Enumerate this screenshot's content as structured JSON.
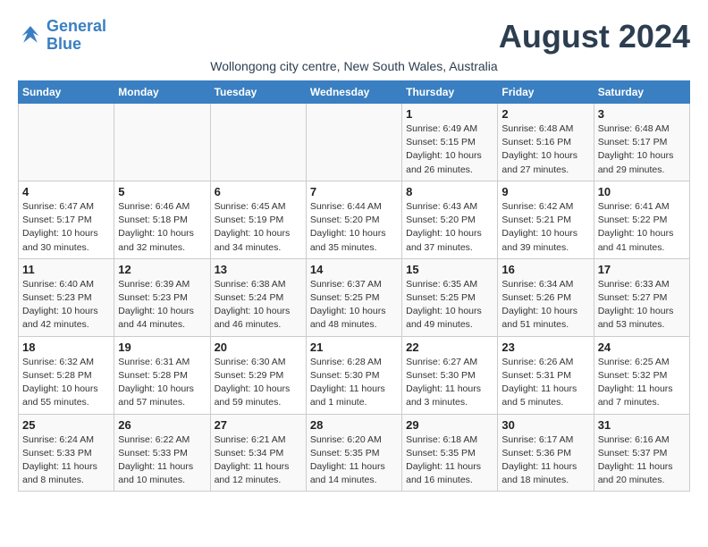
{
  "logo": {
    "line1": "General",
    "line2": "Blue"
  },
  "title": "August 2024",
  "subtitle": "Wollongong city centre, New South Wales, Australia",
  "days_of_week": [
    "Sunday",
    "Monday",
    "Tuesday",
    "Wednesday",
    "Thursday",
    "Friday",
    "Saturday"
  ],
  "weeks": [
    [
      {
        "day": "",
        "info": ""
      },
      {
        "day": "",
        "info": ""
      },
      {
        "day": "",
        "info": ""
      },
      {
        "day": "",
        "info": ""
      },
      {
        "day": "1",
        "info": "Sunrise: 6:49 AM\nSunset: 5:15 PM\nDaylight: 10 hours\nand 26 minutes."
      },
      {
        "day": "2",
        "info": "Sunrise: 6:48 AM\nSunset: 5:16 PM\nDaylight: 10 hours\nand 27 minutes."
      },
      {
        "day": "3",
        "info": "Sunrise: 6:48 AM\nSunset: 5:17 PM\nDaylight: 10 hours\nand 29 minutes."
      }
    ],
    [
      {
        "day": "4",
        "info": "Sunrise: 6:47 AM\nSunset: 5:17 PM\nDaylight: 10 hours\nand 30 minutes."
      },
      {
        "day": "5",
        "info": "Sunrise: 6:46 AM\nSunset: 5:18 PM\nDaylight: 10 hours\nand 32 minutes."
      },
      {
        "day": "6",
        "info": "Sunrise: 6:45 AM\nSunset: 5:19 PM\nDaylight: 10 hours\nand 34 minutes."
      },
      {
        "day": "7",
        "info": "Sunrise: 6:44 AM\nSunset: 5:20 PM\nDaylight: 10 hours\nand 35 minutes."
      },
      {
        "day": "8",
        "info": "Sunrise: 6:43 AM\nSunset: 5:20 PM\nDaylight: 10 hours\nand 37 minutes."
      },
      {
        "day": "9",
        "info": "Sunrise: 6:42 AM\nSunset: 5:21 PM\nDaylight: 10 hours\nand 39 minutes."
      },
      {
        "day": "10",
        "info": "Sunrise: 6:41 AM\nSunset: 5:22 PM\nDaylight: 10 hours\nand 41 minutes."
      }
    ],
    [
      {
        "day": "11",
        "info": "Sunrise: 6:40 AM\nSunset: 5:23 PM\nDaylight: 10 hours\nand 42 minutes."
      },
      {
        "day": "12",
        "info": "Sunrise: 6:39 AM\nSunset: 5:23 PM\nDaylight: 10 hours\nand 44 minutes."
      },
      {
        "day": "13",
        "info": "Sunrise: 6:38 AM\nSunset: 5:24 PM\nDaylight: 10 hours\nand 46 minutes."
      },
      {
        "day": "14",
        "info": "Sunrise: 6:37 AM\nSunset: 5:25 PM\nDaylight: 10 hours\nand 48 minutes."
      },
      {
        "day": "15",
        "info": "Sunrise: 6:35 AM\nSunset: 5:25 PM\nDaylight: 10 hours\nand 49 minutes."
      },
      {
        "day": "16",
        "info": "Sunrise: 6:34 AM\nSunset: 5:26 PM\nDaylight: 10 hours\nand 51 minutes."
      },
      {
        "day": "17",
        "info": "Sunrise: 6:33 AM\nSunset: 5:27 PM\nDaylight: 10 hours\nand 53 minutes."
      }
    ],
    [
      {
        "day": "18",
        "info": "Sunrise: 6:32 AM\nSunset: 5:28 PM\nDaylight: 10 hours\nand 55 minutes."
      },
      {
        "day": "19",
        "info": "Sunrise: 6:31 AM\nSunset: 5:28 PM\nDaylight: 10 hours\nand 57 minutes."
      },
      {
        "day": "20",
        "info": "Sunrise: 6:30 AM\nSunset: 5:29 PM\nDaylight: 10 hours\nand 59 minutes."
      },
      {
        "day": "21",
        "info": "Sunrise: 6:28 AM\nSunset: 5:30 PM\nDaylight: 11 hours\nand 1 minute."
      },
      {
        "day": "22",
        "info": "Sunrise: 6:27 AM\nSunset: 5:30 PM\nDaylight: 11 hours\nand 3 minutes."
      },
      {
        "day": "23",
        "info": "Sunrise: 6:26 AM\nSunset: 5:31 PM\nDaylight: 11 hours\nand 5 minutes."
      },
      {
        "day": "24",
        "info": "Sunrise: 6:25 AM\nSunset: 5:32 PM\nDaylight: 11 hours\nand 7 minutes."
      }
    ],
    [
      {
        "day": "25",
        "info": "Sunrise: 6:24 AM\nSunset: 5:33 PM\nDaylight: 11 hours\nand 8 minutes."
      },
      {
        "day": "26",
        "info": "Sunrise: 6:22 AM\nSunset: 5:33 PM\nDaylight: 11 hours\nand 10 minutes."
      },
      {
        "day": "27",
        "info": "Sunrise: 6:21 AM\nSunset: 5:34 PM\nDaylight: 11 hours\nand 12 minutes."
      },
      {
        "day": "28",
        "info": "Sunrise: 6:20 AM\nSunset: 5:35 PM\nDaylight: 11 hours\nand 14 minutes."
      },
      {
        "day": "29",
        "info": "Sunrise: 6:18 AM\nSunset: 5:35 PM\nDaylight: 11 hours\nand 16 minutes."
      },
      {
        "day": "30",
        "info": "Sunrise: 6:17 AM\nSunset: 5:36 PM\nDaylight: 11 hours\nand 18 minutes."
      },
      {
        "day": "31",
        "info": "Sunrise: 6:16 AM\nSunset: 5:37 PM\nDaylight: 11 hours\nand 20 minutes."
      }
    ]
  ]
}
